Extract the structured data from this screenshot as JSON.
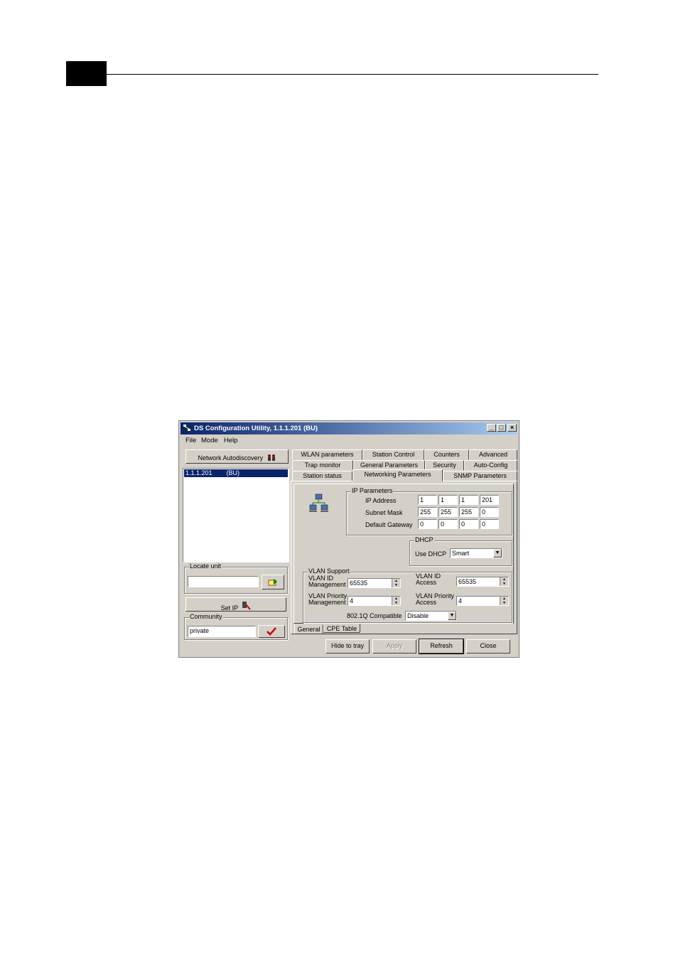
{
  "window": {
    "title": "DS Configuration Utility, 1.1.1.201  (BU)",
    "min_symbol": "_",
    "max_symbol": "□",
    "close_symbol": "×"
  },
  "menu": [
    "File",
    "Mode",
    "Help"
  ],
  "left_panel": {
    "autodiscovery_label": "Network Autodiscovery",
    "unit_list": [
      "1.1.1.201        (BU)"
    ],
    "locate_title": "Locate unit",
    "locate_value": "",
    "set_ip_label": "Set IP",
    "community_title": "Community",
    "community_value": "private"
  },
  "tabs": {
    "row1": [
      "WLAN parameters",
      "Station Control",
      "Counters",
      "Advanced"
    ],
    "row2": [
      "Trap monitor",
      "General Parameters",
      "Security",
      "Auto-Config"
    ],
    "row3": [
      "Station status",
      "Networking Parameters",
      "SNMP Parameters"
    ],
    "active": "Networking Parameters"
  },
  "ip_params": {
    "title": "IP Parameters",
    "ip_label": "IP Address",
    "ip": [
      "1",
      "1",
      "1",
      "201"
    ],
    "mask_label": "Subnet Mask",
    "mask": [
      "255",
      "255",
      "255",
      "0"
    ],
    "gw_label": "Default Gateway",
    "gw": [
      "0",
      "0",
      "0",
      "0"
    ]
  },
  "dhcp": {
    "title": "DHCP",
    "label": "Use DHCP",
    "value": "Smart"
  },
  "vlan": {
    "title": "VLAN Support",
    "id_mgmt_label_1": "VLAN ID",
    "id_mgmt_label_2": "Management",
    "id_mgmt_value": "65535",
    "id_access_label_1": "VLAN ID",
    "id_access_label_2": "Access",
    "id_access_value": "65535",
    "prio_mgmt_label_1": "VLAN Priority",
    "prio_mgmt_label_2": "Management",
    "prio_mgmt_value": "4",
    "prio_access_label_1": "VLAN Priority",
    "prio_access_label_2": "Access",
    "prio_access_value": "4",
    "compat_label": "802.1Q Compatible",
    "compat_value": "Disable"
  },
  "bottom_tabs": [
    "General",
    "CPE Table"
  ],
  "buttons": {
    "hide": "Hide to tray",
    "apply": "Apply",
    "refresh": "Refresh",
    "close": "Close"
  },
  "colors": {
    "titlebar_start": "#0a246a",
    "titlebar_end": "#a6caf0",
    "face": "#d4d0c8"
  }
}
